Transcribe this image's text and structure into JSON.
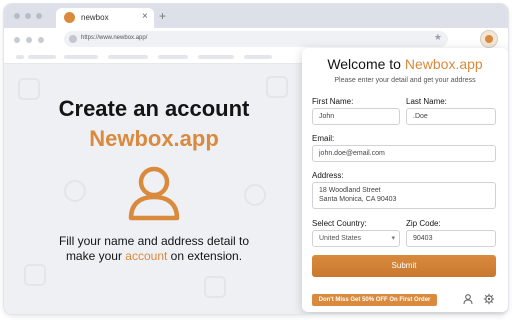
{
  "browser": {
    "tab_title": "newbox",
    "tab_close": "×",
    "new_tab": "+",
    "url": "https://www.newbox.app/",
    "star": "★"
  },
  "hero": {
    "line1": "Create an account",
    "line2": "Newbox.app",
    "desc_pre": "Fill your name and address detail to make your ",
    "desc_accent": "account",
    "desc_post": " on extension."
  },
  "popup": {
    "title_pre": "Welcome to ",
    "title_brand": "Newbox.app",
    "subtitle": "Please enter your detail and get your address",
    "first_name": {
      "label": "First Name:",
      "value": "John"
    },
    "last_name": {
      "label": "Last Name:",
      "value": ".Doe"
    },
    "email": {
      "label": "Email:",
      "value": "john.doe@email.com"
    },
    "address": {
      "label": "Address:",
      "line1": "18 Woodland Street",
      "line2": "Santa Monica, CA 90403"
    },
    "country": {
      "label": "Select Country:",
      "value": "United States"
    },
    "zip": {
      "label": "Zip Code:",
      "value": "90403"
    },
    "submit_label": "Submit",
    "promo": "Don't Miss Get 50% OFF On First Order"
  },
  "colors": {
    "accent": "#d98a3d",
    "text": "#141414",
    "background": "#eff0f4"
  }
}
